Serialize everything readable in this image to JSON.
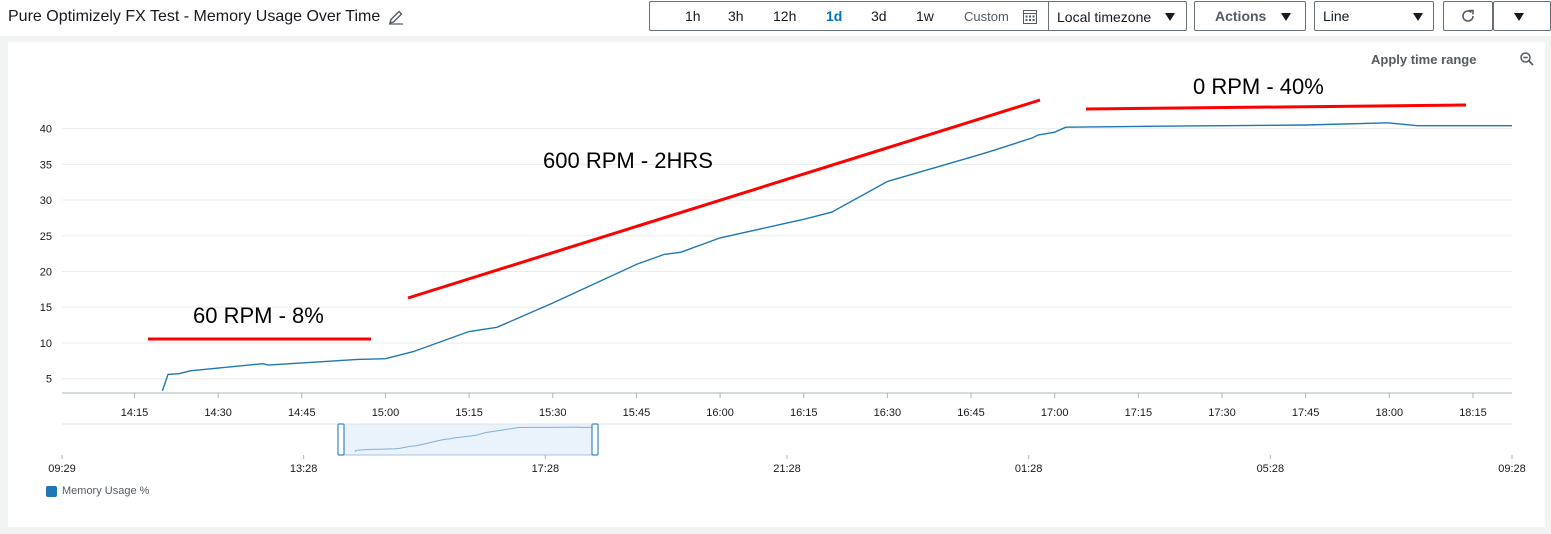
{
  "header": {
    "title": "Pure Optimizely FX Test - Memory Usage Over Time",
    "ranges": [
      "1h",
      "3h",
      "12h",
      "1d",
      "3d",
      "1w"
    ],
    "active_range": "1d",
    "custom_label": "Custom",
    "timezone_label": "Local timezone",
    "actions_label": "Actions",
    "chart_type_label": "Line"
  },
  "panel": {
    "apply_time_range_label": "Apply time range"
  },
  "annotations": {
    "low": "60 RPM - 8%",
    "ramp": "600 RPM - 2HRS",
    "idle": "0 RPM  - 40%"
  },
  "colors": {
    "series": "#1f77b4",
    "annotation": "#ff0000",
    "accent": "#0073bb",
    "navigator_window": "#eaf2fb"
  },
  "icons": [
    "edit-icon",
    "calendar-icon",
    "caret-down-icon",
    "refresh-icon",
    "zoom-out-icon"
  ],
  "chart_data": {
    "type": "line",
    "title": "",
    "xlabel": "",
    "ylabel": "",
    "x_ticks": [
      "14:15",
      "14:30",
      "14:45",
      "15:00",
      "15:15",
      "15:30",
      "15:45",
      "16:00",
      "16:15",
      "16:30",
      "16:45",
      "17:00",
      "17:15",
      "17:30",
      "17:45",
      "18:00",
      "18:15"
    ],
    "y_ticks": [
      5,
      10,
      15,
      20,
      25,
      30,
      35,
      40
    ],
    "ylim": [
      3,
      44
    ],
    "xlim": [
      "14:02",
      "18:22"
    ],
    "grid": true,
    "legend_position": "bottom-left",
    "series": [
      {
        "name": "Memory Usage %",
        "x": [
          "14:20",
          "14:21",
          "14:23",
          "14:25",
          "14:38",
          "14:39",
          "14:55",
          "15:00",
          "15:05",
          "15:15",
          "15:20",
          "15:30",
          "15:35",
          "15:45",
          "15:50",
          "15:53",
          "16:00",
          "16:15",
          "16:20",
          "16:30",
          "16:45",
          "16:48",
          "16:56",
          "16:57",
          "17:00",
          "17:02",
          "17:15",
          "17:30",
          "17:45",
          "17:59",
          "18:00",
          "18:05",
          "18:22"
        ],
        "values": [
          3.3,
          5.6,
          5.7,
          6.1,
          7.1,
          6.9,
          7.7,
          7.8,
          8.8,
          11.6,
          12.2,
          15.6,
          17.4,
          21.0,
          22.4,
          22.7,
          24.7,
          27.3,
          28.3,
          32.6,
          36.0,
          36.7,
          38.7,
          39.1,
          39.5,
          40.2,
          40.3,
          40.4,
          40.5,
          40.8,
          40.8,
          40.4,
          40.4
        ]
      }
    ],
    "navigator": {
      "x_ticks": [
        "09:29",
        "13:28",
        "17:28",
        "21:28",
        "01:28",
        "05:28",
        "09:28"
      ]
    }
  }
}
